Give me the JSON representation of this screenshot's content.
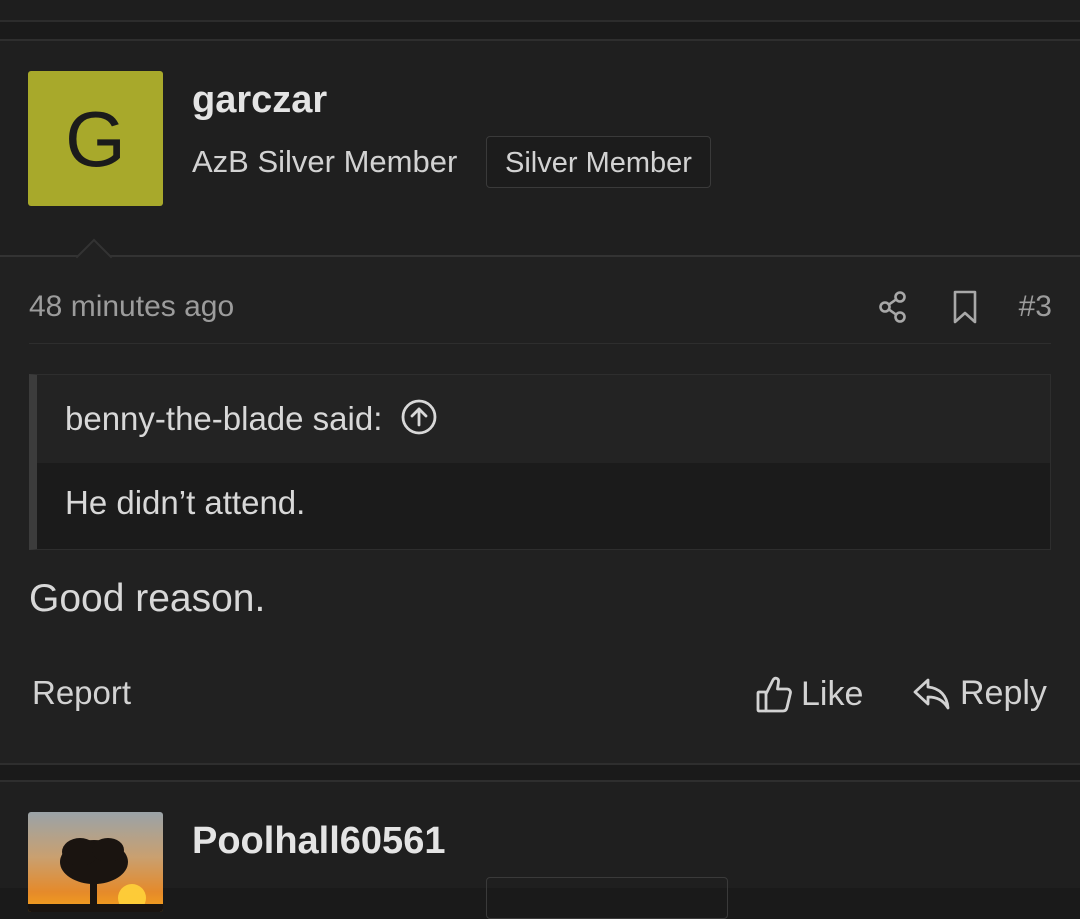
{
  "post": {
    "avatar_letter": "G",
    "avatar_color": "#a8a92b",
    "username": "garczar",
    "user_title": "AzB Silver Member",
    "badge": "Silver Member",
    "time": "48 minutes ago",
    "post_number": "#3",
    "icons": [
      "share-icon",
      "bookmark-icon",
      "arrow-up-circle-icon",
      "thumbs-up-icon",
      "reply-icon"
    ],
    "quote": {
      "author": "benny-the-blade said:",
      "text": "He didn’t attend."
    },
    "body": "Good reason.",
    "actions": {
      "report": "Report",
      "like": "Like",
      "reply": "Reply"
    }
  },
  "next_post": {
    "username": "Poolhall60561"
  }
}
